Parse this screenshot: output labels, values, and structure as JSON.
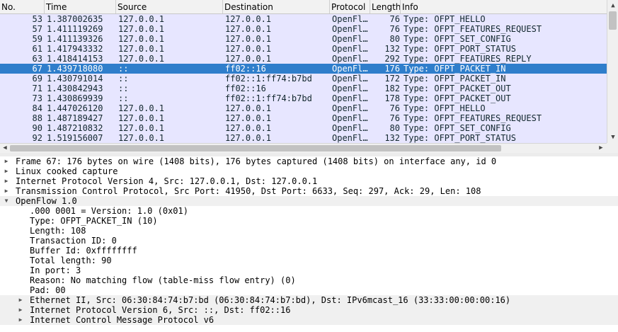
{
  "columns": [
    "No.",
    "Time",
    "Source",
    "Destination",
    "Protocol",
    "Length",
    "Info"
  ],
  "packets": [
    {
      "no": "53",
      "time": "1.387002635",
      "src": "127.0.0.1",
      "dst": "127.0.0.1",
      "proto": "OpenFl…",
      "len": "76",
      "info": "Type: OFPT_HELLO"
    },
    {
      "no": "57",
      "time": "1.411119269",
      "src": "127.0.0.1",
      "dst": "127.0.0.1",
      "proto": "OpenFl…",
      "len": "76",
      "info": "Type: OFPT_FEATURES_REQUEST"
    },
    {
      "no": "59",
      "time": "1.411139326",
      "src": "127.0.0.1",
      "dst": "127.0.0.1",
      "proto": "OpenFl…",
      "len": "80",
      "info": "Type: OFPT_SET_CONFIG"
    },
    {
      "no": "61",
      "time": "1.417943332",
      "src": "127.0.0.1",
      "dst": "127.0.0.1",
      "proto": "OpenFl…",
      "len": "132",
      "info": "Type: OFPT_PORT_STATUS"
    },
    {
      "no": "63",
      "time": "1.418414153",
      "src": "127.0.0.1",
      "dst": "127.0.0.1",
      "proto": "OpenFl…",
      "len": "292",
      "info": "Type: OFPT_FEATURES_REPLY"
    },
    {
      "no": "67",
      "time": "1.439718080",
      "src": "::",
      "dst": "ff02::16",
      "proto": "OpenFl…",
      "len": "176",
      "info": "Type: OFPT_PACKET_IN",
      "selected": true
    },
    {
      "no": "69",
      "time": "1.430791014",
      "src": "::",
      "dst": "ff02::1:ff74:b7bd",
      "proto": "OpenFl…",
      "len": "172",
      "info": "Type: OFPT_PACKET_IN"
    },
    {
      "no": "71",
      "time": "1.430842943",
      "src": "::",
      "dst": "ff02::16",
      "proto": "OpenFl…",
      "len": "182",
      "info": "Type: OFPT_PACKET_OUT"
    },
    {
      "no": "73",
      "time": "1.430869939",
      "src": "::",
      "dst": "ff02::1:ff74:b7bd",
      "proto": "OpenFl…",
      "len": "178",
      "info": "Type: OFPT_PACKET_OUT"
    },
    {
      "no": "84",
      "time": "1.447026120",
      "src": "127.0.0.1",
      "dst": "127.0.0.1",
      "proto": "OpenFl…",
      "len": "76",
      "info": "Type: OFPT_HELLO"
    },
    {
      "no": "88",
      "time": "1.487189427",
      "src": "127.0.0.1",
      "dst": "127.0.0.1",
      "proto": "OpenFl…",
      "len": "76",
      "info": "Type: OFPT_FEATURES_REQUEST"
    },
    {
      "no": "90",
      "time": "1.487210832",
      "src": "127.0.0.1",
      "dst": "127.0.0.1",
      "proto": "OpenFl…",
      "len": "80",
      "info": "Type: OFPT_SET_CONFIG"
    },
    {
      "no": "92",
      "time": "1.519156007",
      "src": "127.0.0.1",
      "dst": "127.0.0.1",
      "proto": "OpenFl…",
      "len": "132",
      "info": "Type: OFPT_PORT_STATUS"
    }
  ],
  "details": [
    {
      "text": "Frame 67: 176 bytes on wire (1408 bits), 176 bytes captured (1408 bits) on interface any, id 0",
      "level": 0,
      "expander": "collapsed",
      "alt": false
    },
    {
      "text": "Linux cooked capture",
      "level": 0,
      "expander": "collapsed",
      "alt": false
    },
    {
      "text": "Internet Protocol Version 4, Src: 127.0.0.1, Dst: 127.0.0.1",
      "level": 0,
      "expander": "collapsed",
      "alt": false
    },
    {
      "text": "Transmission Control Protocol, Src Port: 41950, Dst Port: 6633, Seq: 297, Ack: 29, Len: 108",
      "level": 0,
      "expander": "collapsed",
      "alt": false
    },
    {
      "text": "OpenFlow 1.0",
      "level": 0,
      "expander": "expanded",
      "alt": true
    },
    {
      "text": ".000 0001 = Version: 1.0 (0x01)",
      "level": 1,
      "expander": "none",
      "alt": false
    },
    {
      "text": "Type: OFPT_PACKET_IN (10)",
      "level": 1,
      "expander": "none",
      "alt": false
    },
    {
      "text": "Length: 108",
      "level": 1,
      "expander": "none",
      "alt": false
    },
    {
      "text": "Transaction ID: 0",
      "level": 1,
      "expander": "none",
      "alt": false
    },
    {
      "text": "Buffer Id: 0xffffffff",
      "level": 1,
      "expander": "none",
      "alt": false
    },
    {
      "text": "Total length: 90",
      "level": 1,
      "expander": "none",
      "alt": false
    },
    {
      "text": "In port: 3",
      "level": 1,
      "expander": "none",
      "alt": false
    },
    {
      "text": "Reason: No matching flow (table-miss flow entry) (0)",
      "level": 1,
      "expander": "none",
      "alt": false
    },
    {
      "text": "Pad: 00",
      "level": 1,
      "expander": "none",
      "alt": false
    },
    {
      "text": "Ethernet II, Src: 06:30:84:74:b7:bd (06:30:84:74:b7:bd), Dst: IPv6mcast_16 (33:33:00:00:00:16)",
      "level": 1,
      "expander": "collapsed",
      "alt": true
    },
    {
      "text": "Internet Protocol Version 6, Src: ::, Dst: ff02::16",
      "level": 1,
      "expander": "collapsed",
      "alt": true
    },
    {
      "text": "Internet Control Message Protocol v6",
      "level": 1,
      "expander": "collapsed",
      "alt": true
    }
  ],
  "colors": {
    "row_bg": "#e7e6ff",
    "selected_bg": "#2f7ecb",
    "row_text": "#12272e"
  },
  "icons": {
    "collapsed": "expand-arrow-icon",
    "expanded": "collapse-arrow-icon"
  }
}
